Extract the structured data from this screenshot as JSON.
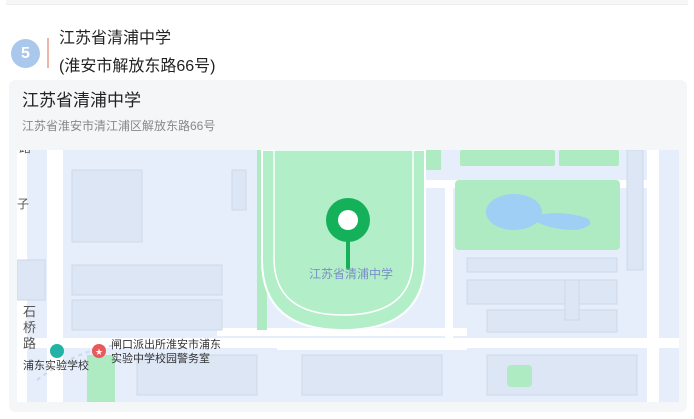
{
  "header": {
    "step_number": "5",
    "title_line1": "江苏省清浦中学",
    "title_line2": "(淮安市解放东路66号)"
  },
  "map_card": {
    "name": "江苏省清浦中学",
    "address": "江苏省淮安市清江浦区解放东路66号"
  },
  "map": {
    "marker_label": "江苏省清浦中学",
    "poi_school": "浦东实验学校",
    "poi_police_line1": "闸口派出所淮安市浦东",
    "poi_police_line2": "实验中学校园警务室",
    "road_label_1": "石",
    "road_label_2": "桥",
    "road_label_3": "路",
    "edge_label_1": "子",
    "edge_label_2": "路",
    "colors": {
      "marker": "#14b05a",
      "field": "#b2eec7",
      "park": "#aeeac2",
      "water": "#9fcff4",
      "police": "#e85a5a",
      "school_icon": "#22b2a6"
    }
  }
}
